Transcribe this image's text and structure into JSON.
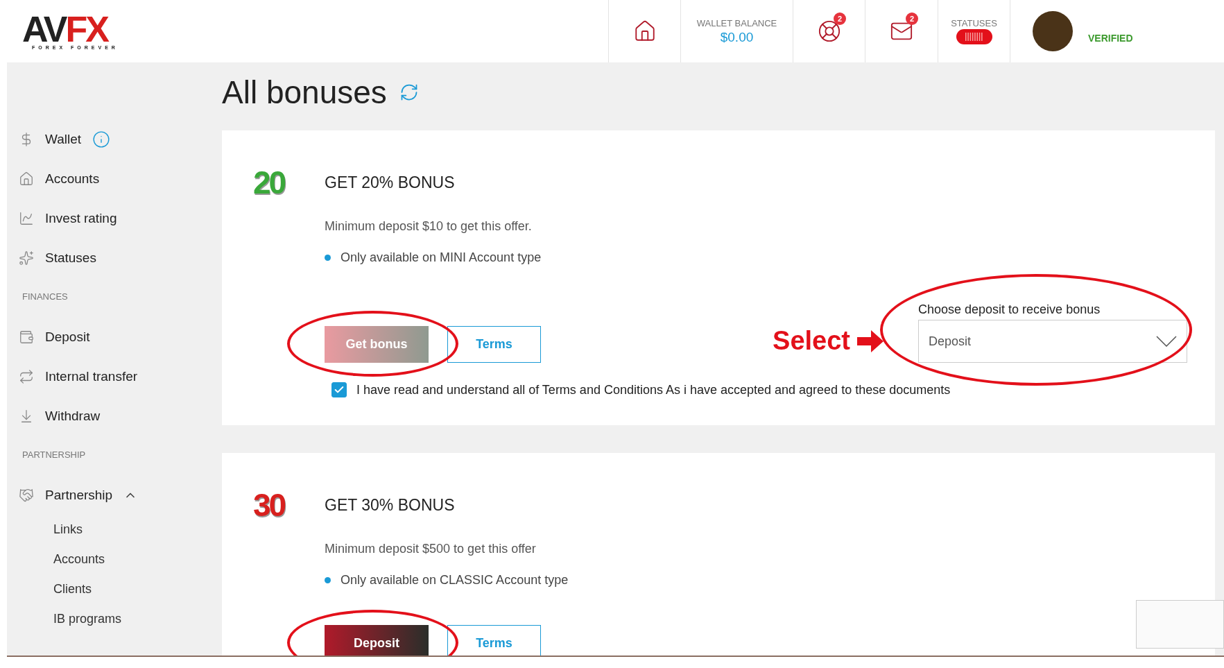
{
  "logo": {
    "mark": "AV",
    "accent": "FX",
    "tagline": "FOREX FOREVER"
  },
  "header": {
    "wallet_balance": {
      "label": "WALLET BALANCE",
      "value": "$0.00"
    },
    "notifications_badge": "2",
    "messages_badge": "2",
    "statuses_label": "STATUSES",
    "user_status": "VERIFIED"
  },
  "sidebar": [
    {
      "items": [
        {
          "label": "Wallet",
          "info": true
        },
        {
          "label": "Accounts",
          "info": false
        },
        {
          "label": "Invest rating",
          "info": false
        },
        {
          "label": "Statuses",
          "info": false
        }
      ]
    },
    {
      "heading": "FINANCES",
      "items": [
        {
          "label": "Deposit",
          "info": false
        },
        {
          "label": "Internal transfer",
          "info": false
        },
        {
          "label": "Withdraw",
          "info": false
        }
      ]
    },
    {
      "heading": "PARTNERSHIP",
      "items": [
        {
          "label": "Partnership",
          "info": false,
          "expanded": true,
          "children": [
            {
              "label": "Links"
            },
            {
              "label": "Accounts"
            },
            {
              "label": "Clients"
            },
            {
              "label": "IB programs"
            }
          ]
        }
      ]
    }
  ],
  "page_title": "All bonuses",
  "bonuses": [
    {
      "badge": "20",
      "color": "#3aa83a",
      "title": "GET 20% BONUS",
      "description": "Minimum deposit $10 to get this offer.",
      "condition": "Only available on MINI Account type",
      "primary": {
        "label": "Get bonus",
        "disabled": true,
        "highlighted": true
      },
      "terms": "Terms",
      "callout": "Select",
      "select": {
        "label": "Choose deposit to receive bonus",
        "value": "Deposit",
        "highlighted": true
      },
      "agreement": {
        "text": "I have read and understand all of Terms and Conditions As i have accepted and agreed to these documents",
        "checked": true
      }
    },
    {
      "badge": "30",
      "color": "#d8201e",
      "title": "GET 30% BONUS",
      "description": "Minimum deposit $500 to get this offer",
      "condition": "Only available on CLASSIC Account type",
      "primary": {
        "label": "Deposit",
        "disabled": false,
        "highlighted": true
      },
      "terms": "Terms"
    }
  ]
}
